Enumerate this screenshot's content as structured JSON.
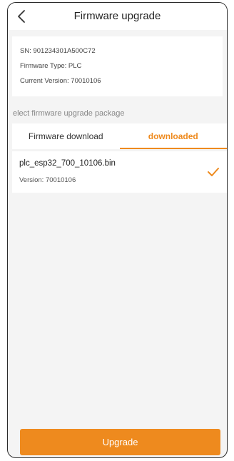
{
  "header": {
    "title": "Firmware upgrade",
    "back_icon": "chevron-left-icon"
  },
  "info": {
    "sn": "SN: 901234301A500C72",
    "firmware_type": "Firmware Type: PLC",
    "current_version": "Current Version: 70010106"
  },
  "section_label": "elect firmware upgrade package",
  "tabs": [
    {
      "label": "Firmware download",
      "active": false
    },
    {
      "label": "downloaded",
      "active": true
    }
  ],
  "package": {
    "file_name": "plc_esp32_700_10106.bin",
    "version": "Version: 70010106",
    "selected": true
  },
  "upgrade_label": "Upgrade",
  "colors": {
    "accent": "#ee8a1e",
    "background": "#f4f4f4"
  }
}
